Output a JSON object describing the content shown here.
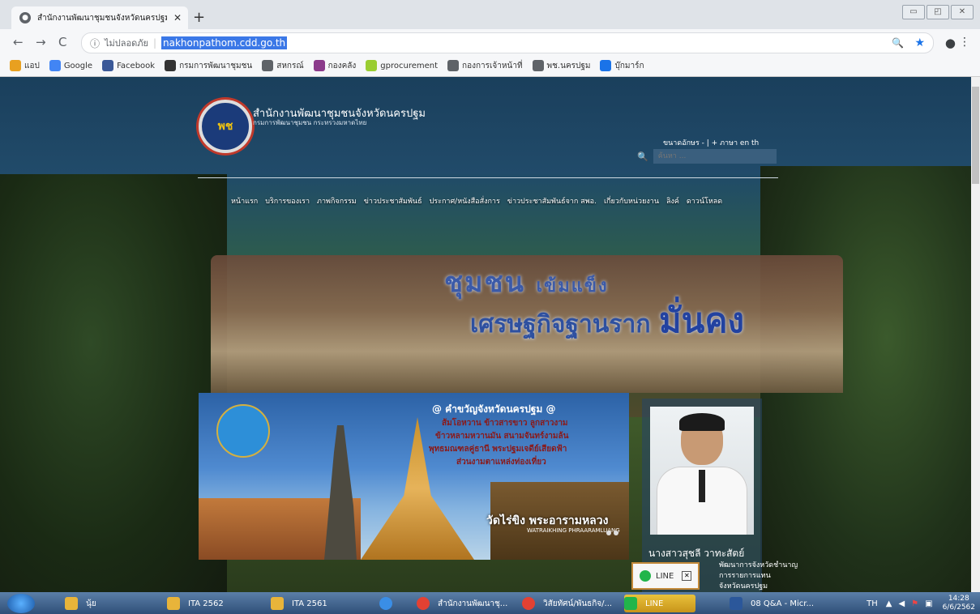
{
  "browser": {
    "tab_title": "สำนักงานพัฒนาชุมชนจังหวัดนครปฐม",
    "tab_close": "✕",
    "new_tab": "+",
    "window_buttons": [
      "▭",
      "◰",
      "✕"
    ],
    "security_label": "ไม่ปลอดภัย",
    "url": "nakhonpathom.cdd.go.th",
    "nav": {
      "back": "←",
      "forward": "→",
      "reload": "C"
    },
    "bookmarks": [
      {
        "label": "แอป",
        "icon": "apps-icon",
        "color": "#e8a020"
      },
      {
        "label": "Google",
        "icon": "google-icon",
        "color": "#4285f4"
      },
      {
        "label": "Facebook",
        "icon": "facebook-icon",
        "color": "#3b5998"
      },
      {
        "label": "กรมการพัฒนาชุมชน",
        "icon": "cdd-icon",
        "color": "#333333"
      },
      {
        "label": "สหกรณ์",
        "icon": "globe-icon",
        "color": "#5f6368"
      },
      {
        "label": "กองคลัง",
        "icon": "circle-icon",
        "color": "#8b3a8b"
      },
      {
        "label": "gprocurement",
        "icon": "gproc-icon",
        "color": "#9acd32"
      },
      {
        "label": "กองการเจ้าหน้าที่",
        "icon": "globe-icon",
        "color": "#5f6368"
      },
      {
        "label": "พช.นครปฐม",
        "icon": "globe-icon",
        "color": "#5f6368"
      },
      {
        "label": "บุ๊กมาร์ก",
        "icon": "star-icon",
        "color": "#1a73e8"
      }
    ]
  },
  "site": {
    "title": "สำนักงานพัฒนาชุมชนจังหวัดนครปฐม",
    "subtitle": "กรมการพัฒนาชุมชน กระทรวงมหาดไทย",
    "font_size": "ขนาดอักษร  -  |  +   ภาษา  en  th",
    "search_placeholder": "ค้นหา ...",
    "nav": [
      "หน้าแรก",
      "บริการของเรา",
      "ภาพกิจกรรม",
      "ข่าวประชาสัมพันธ์",
      "ประกาศ/หนังสือสั่งการ",
      "ข่าวประชาสัมพันธ์จาก สพอ.",
      "เกี่ยวกับหน่วยงาน",
      "ลิงค์",
      "ดาวน์โหลด"
    ],
    "slogan_1a": "ชุมชน",
    "slogan_1b": "เข้มแข็ง",
    "slogan_2a": "เศรษฐกิจฐานราก",
    "slogan_2b": "มั่นคง",
    "banner": {
      "title": "@ คำขวัญจังหวัดนครปฐม @",
      "lines": [
        "ส้มโอหวาน ข้าวสารขาว ลูกสาวงาม",
        "ข้าวหลามหวานมัน สนามจันทร์งามล้น",
        "พุทธมณฑลคู่ธานี พระปฐมเจดีย์เสียดฟ้า",
        "ส่วนงามตาแหล่งท่องเที่ยว"
      ],
      "temple": "วัดไร่ขิง พระอารามหลวง",
      "temple_en": "WATRAIKHING PHRAARAMLUANG"
    },
    "governor": {
      "name": "นางสาวสุชลี วาทะสัตย์",
      "lines": [
        "พัฒนาการจังหวัดชำนาญ",
        "การรายการแทน",
        "จังหวัดนครปฐม"
      ]
    },
    "line_widget": {
      "label": "LINE",
      "close": "✕"
    }
  },
  "taskbar": {
    "items": [
      {
        "label": "นุ้ย"
      },
      {
        "label": "ITA 2562"
      },
      {
        "label": "ITA 2561"
      },
      {
        "label": ""
      },
      {
        "label": "สำนักงานพัฒนาชุ..."
      },
      {
        "label": "วิสัยทัศน์/พันธกิจ/..."
      },
      {
        "label": "LINE"
      },
      {
        "label": "08 Q&A - Micr..."
      }
    ],
    "lang": "TH",
    "time": "14:28",
    "date": "6/6/2562"
  },
  "colors": {
    "accent": "#1a73e8",
    "site_header": "#1f4a6a",
    "taskbar": "#2f4f78",
    "line_green": "#21b54a"
  }
}
